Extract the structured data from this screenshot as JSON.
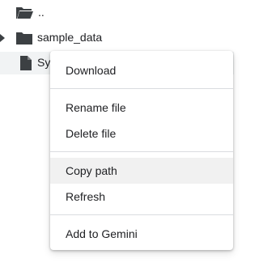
{
  "file_browser": {
    "parent_dir": {
      "label": "..",
      "icon": "folder-open-icon"
    },
    "items": [
      {
        "label": "sample_data",
        "icon": "folder-icon",
        "expandable": true
      },
      {
        "label": "Sy",
        "icon": "file-icon",
        "selected": true
      }
    ]
  },
  "context_menu": {
    "items": [
      {
        "label": "Download"
      },
      {
        "label": "Rename file"
      },
      {
        "label": "Delete file"
      },
      {
        "label": "Copy path",
        "highlighted": true
      },
      {
        "label": "Refresh"
      },
      {
        "label": "Add to Gemini"
      }
    ]
  },
  "colors": {
    "text": "#202124",
    "icon": "#3c4043",
    "selected_row": "#f1f3f4",
    "hover_item": "#f1f1f1",
    "divider": "#dadce0"
  }
}
